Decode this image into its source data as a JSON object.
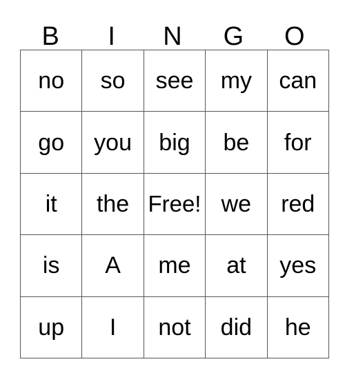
{
  "card": {
    "headers": [
      "B",
      "I",
      "N",
      "G",
      "O"
    ],
    "rows": [
      [
        "no",
        "so",
        "see",
        "my",
        "can"
      ],
      [
        "go",
        "you",
        "big",
        "be",
        "for"
      ],
      [
        "it",
        "the",
        "Free!",
        "we",
        "red"
      ],
      [
        "is",
        "A",
        "me",
        "at",
        "yes"
      ],
      [
        "up",
        "I",
        "not",
        "did",
        "he"
      ]
    ],
    "free_space": {
      "label": "Free!",
      "row": 2,
      "column": 2
    },
    "colors": {
      "background": "#ffffff",
      "text": "#000000",
      "grid_line": "#555555"
    }
  }
}
